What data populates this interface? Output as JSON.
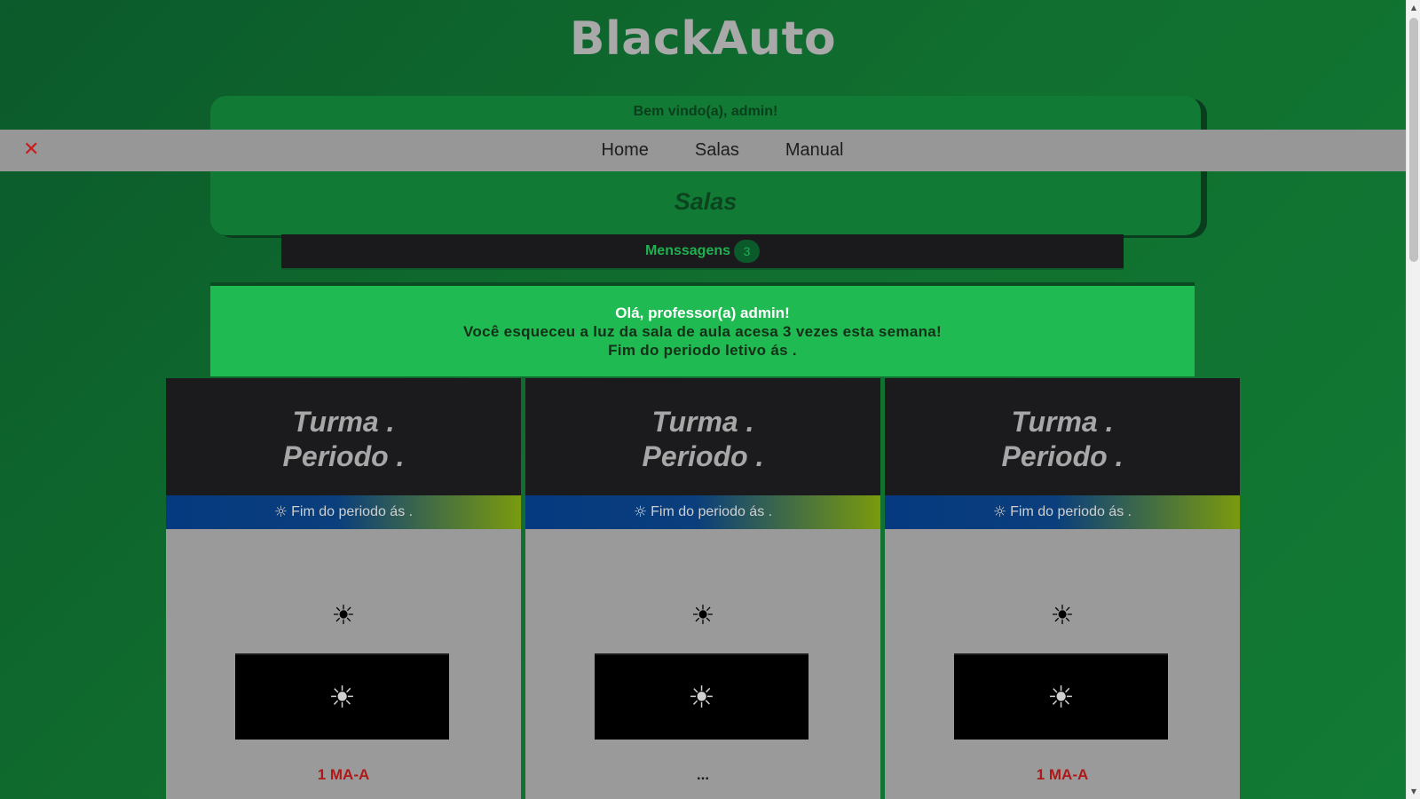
{
  "brand": {
    "title": "BlackAuto"
  },
  "header": {
    "welcome": "Bem vindo(a), admin!",
    "section_title": "Salas"
  },
  "nav": {
    "close_icon": "close-icon",
    "links": [
      {
        "label": "Home"
      },
      {
        "label": "Salas"
      },
      {
        "label": "Manual"
      }
    ]
  },
  "messages": {
    "label": "Menssagens",
    "count": "3"
  },
  "alert": {
    "title": "Olá, professor(a) admin!",
    "line1": "Você esqueceu a luz da sala de aula acesa 3 vezes esta semana!",
    "line2": "Fim do periodo letivo ás ."
  },
  "cards": [
    {
      "turma": "Turma .",
      "periodo": "Periodo .",
      "band_icon": "☼",
      "band_text": "Fim do periodo ás .",
      "sun_icon": "☀",
      "screen_icon": "☀",
      "label": "1 MA-A"
    },
    {
      "turma": "Turma .",
      "periodo": "Periodo .",
      "band_icon": "☼",
      "band_text": "Fim do periodo ás .",
      "sun_icon": "☀",
      "screen_icon": "☀",
      "label": "..."
    },
    {
      "turma": "Turma .",
      "periodo": "Periodo .",
      "band_icon": "☼",
      "band_text": "Fim do periodo ás .",
      "sun_icon": "☀",
      "screen_icon": "☀",
      "label": "1 MA-A"
    }
  ],
  "colors": {
    "background": "#0b5a2b",
    "panel": "#117a35",
    "alert": "#1fba51",
    "accent_red": "#b01818",
    "nav_bar": "#979797"
  }
}
